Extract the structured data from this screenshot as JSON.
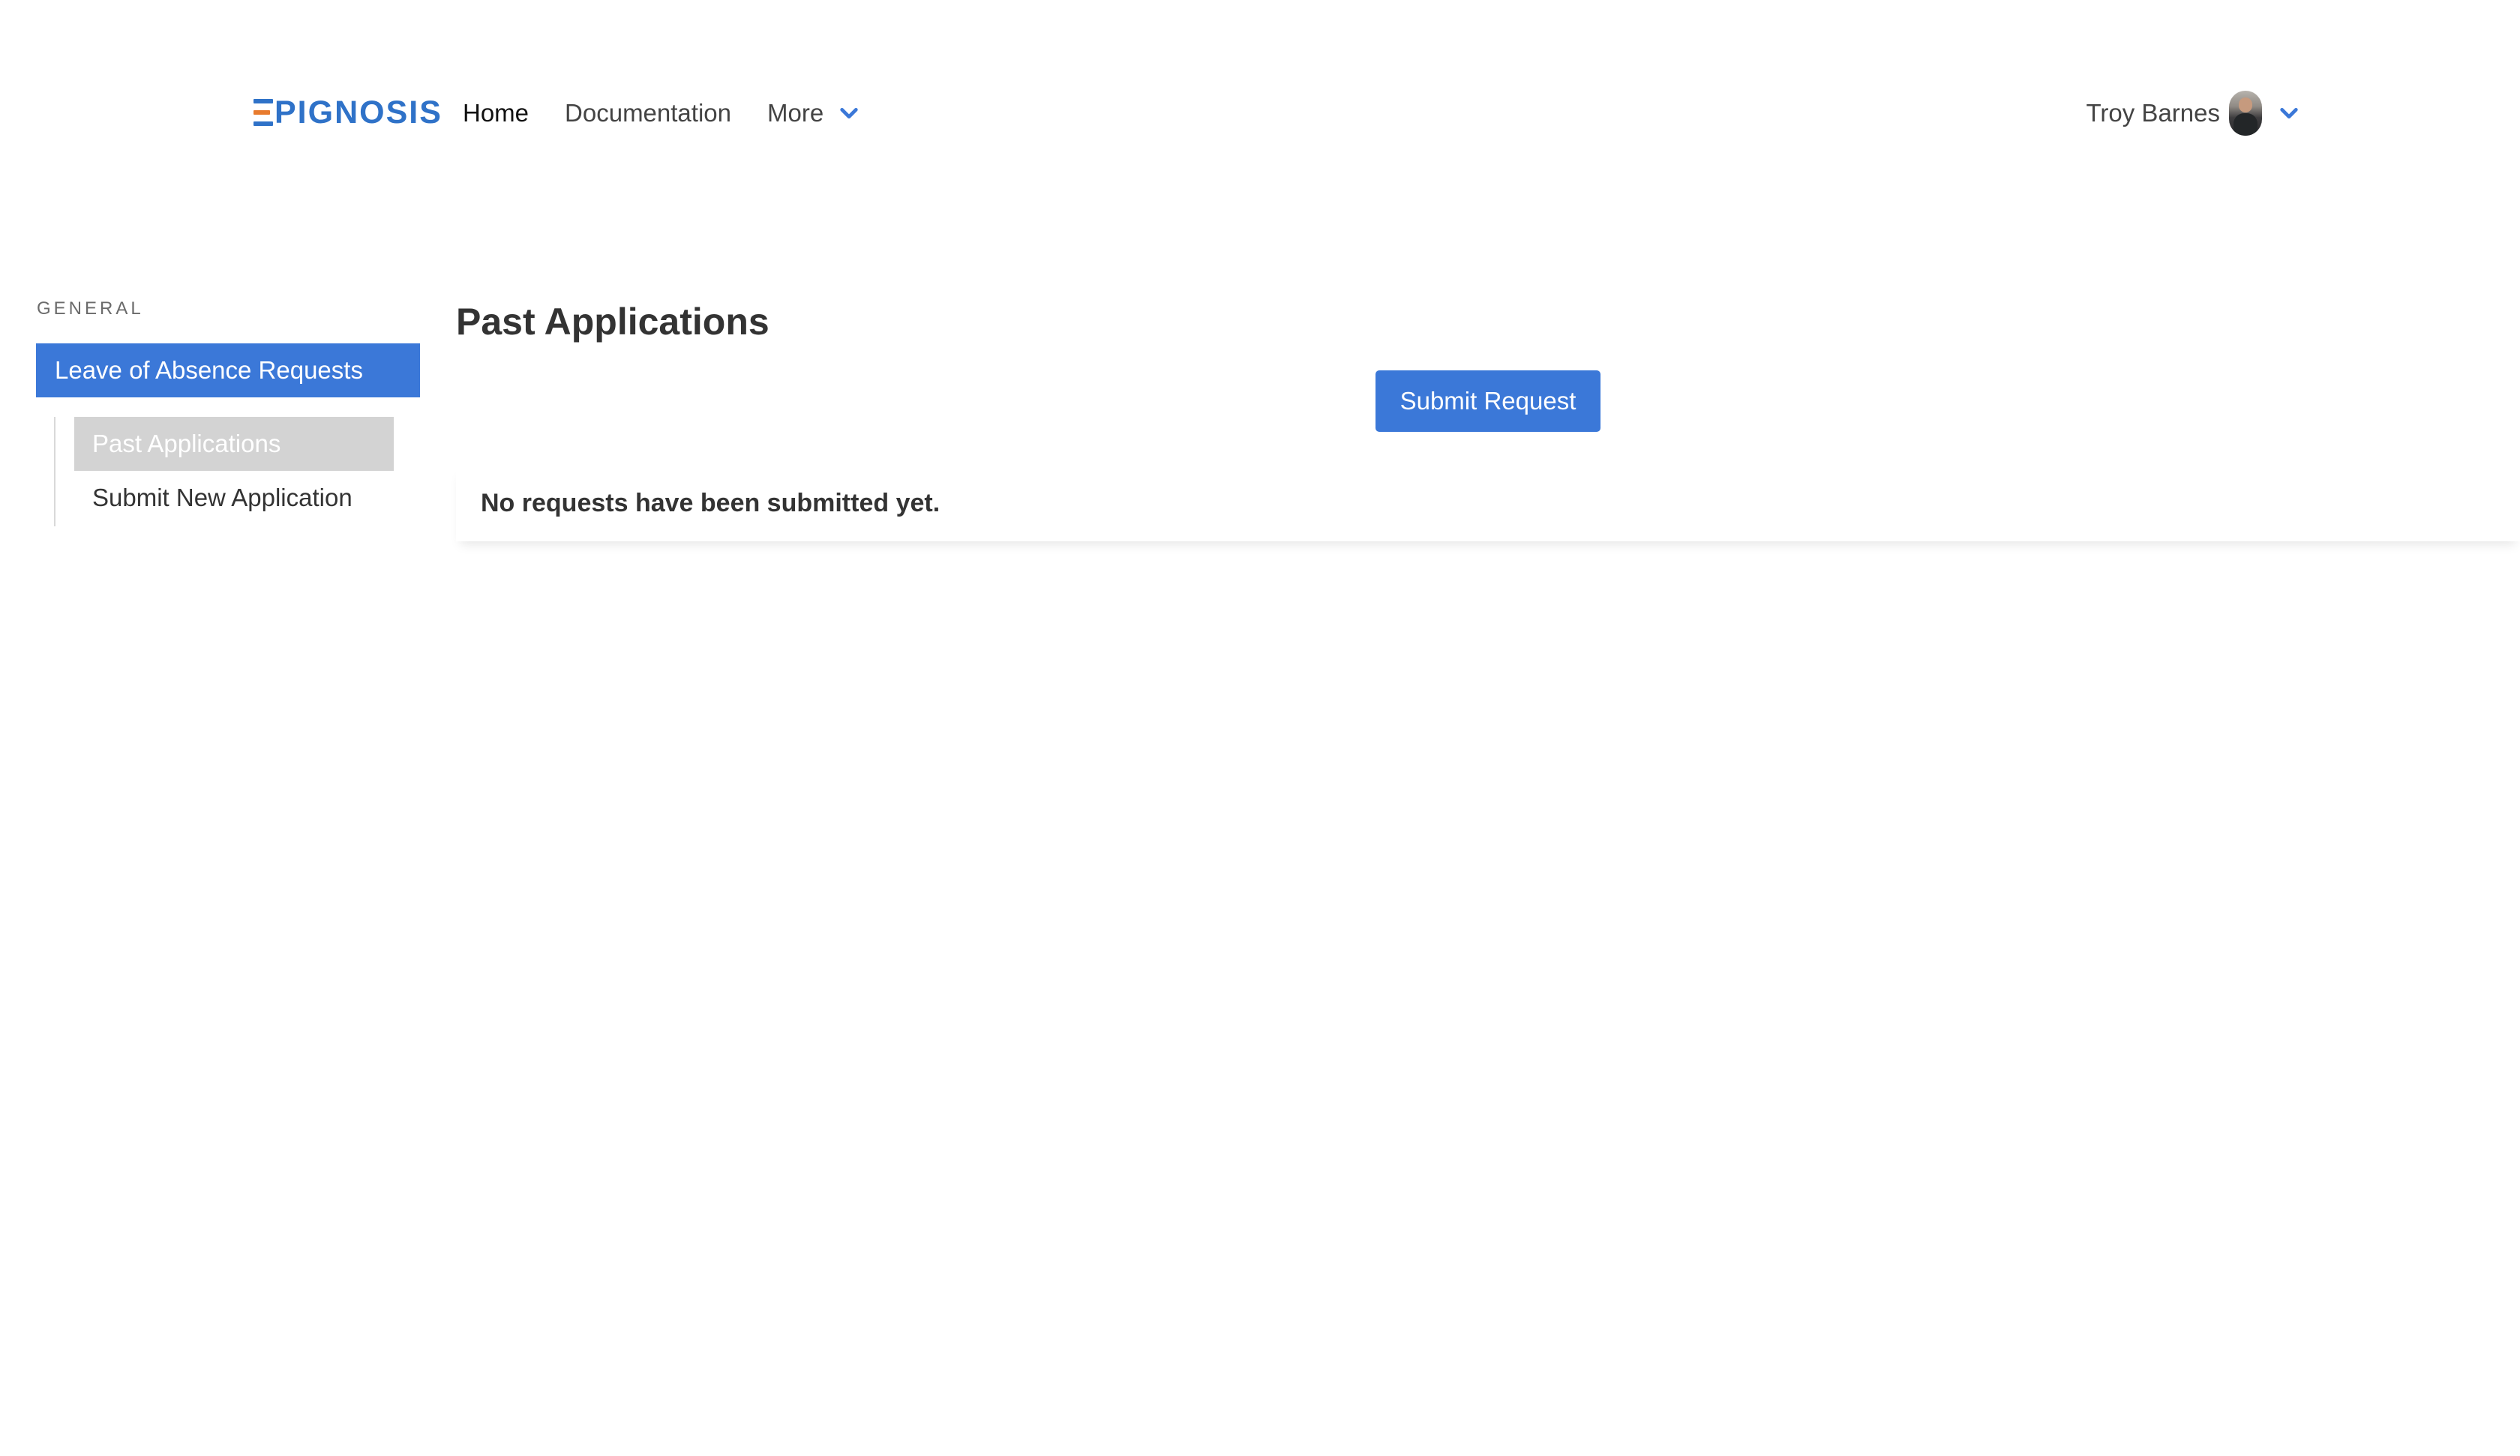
{
  "header": {
    "logo_text": "PIGNOSIS",
    "nav": {
      "home": "Home",
      "documentation": "Documentation",
      "more": "More"
    },
    "user": {
      "name": "Troy Barnes"
    }
  },
  "sidebar": {
    "section_label": "GENERAL",
    "group_label": "Leave of Absence Requests",
    "items": [
      {
        "label": "Past Applications",
        "selected": true
      },
      {
        "label": "Submit New Application",
        "selected": false
      }
    ]
  },
  "main": {
    "title": "Past Applications",
    "submit_label": "Submit Request",
    "empty_message": "No requests have been submitted yet."
  },
  "colors": {
    "accent": "#3b78d8",
    "brand_blue": "#2f72c8",
    "brand_orange": "#e87b2e",
    "selected_bg": "#d3d3d3"
  },
  "icons": {
    "more_dropdown": "chevron-down-icon",
    "user_dropdown": "chevron-down-icon"
  }
}
